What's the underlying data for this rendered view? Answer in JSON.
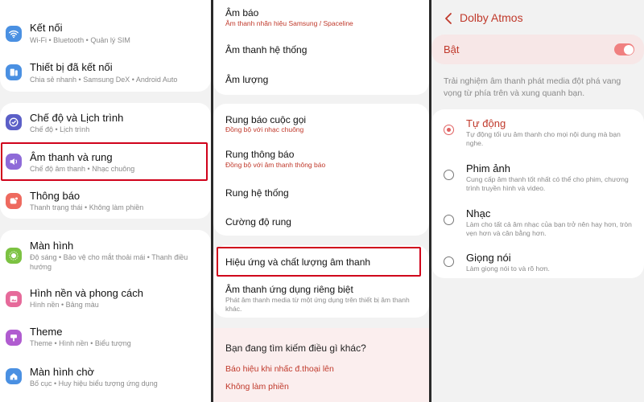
{
  "panel1": {
    "items": [
      {
        "title": "Kết nối",
        "subtitle": "Wi-Fi  •  Bluetooth  •  Quản lý SIM",
        "icon": "wifi-icon",
        "color": "#4a90e2"
      },
      {
        "title": "Thiết bị đã kết nối",
        "subtitle": "Chia sẻ nhanh  •  Samsung DeX  •  Android Auto",
        "icon": "devices-icon",
        "color": "#4a90e2"
      },
      {
        "title": "Chế độ và Lịch trình",
        "subtitle": "Chế độ  •  Lịch trình",
        "icon": "check-circle-icon",
        "color": "#5b5fc7"
      },
      {
        "title": "Âm thanh và rung",
        "subtitle": "Chế độ âm thanh  •  Nhạc chuông",
        "icon": "volume-icon",
        "color": "#8e6ad8"
      },
      {
        "title": "Thông báo",
        "subtitle": "Thanh trạng thái  •  Không làm phiền",
        "icon": "notification-icon",
        "color": "#ee6a5f"
      },
      {
        "title": "Màn hình",
        "subtitle": "Độ sáng  •  Bảo vệ cho mắt thoải mái  •  Thanh điều hướng",
        "icon": "sun-icon",
        "color": "#7cc242"
      },
      {
        "title": "Hình nền và phong cách",
        "subtitle": "Hình nền  •  Bảng màu",
        "icon": "image-icon",
        "color": "#e66a9a"
      },
      {
        "title": "Theme",
        "subtitle": "Theme  •  Hình nền  •  Biểu tượng",
        "icon": "theme-icon",
        "color": "#b05cd0"
      },
      {
        "title": "Màn hình chờ",
        "subtitle": "Bố cục  •  Huy hiệu biểu tượng ứng dụng",
        "icon": "home-icon",
        "color": "#4a90e2"
      }
    ]
  },
  "panel2": {
    "items": [
      {
        "title": "Âm báo",
        "subtitle": "Âm thanh nhãn hiệu Samsung / Spaceline"
      },
      {
        "title": "Âm thanh hệ thống",
        "subtitle": ""
      },
      {
        "title": "Âm lượng",
        "subtitle": ""
      },
      {
        "title": "Rung báo cuộc gọi",
        "subtitle": "Đồng bộ với nhạc chuông"
      },
      {
        "title": "Rung thông báo",
        "subtitle": "Đồng bộ với âm thanh thông báo"
      },
      {
        "title": "Rung hệ thống",
        "subtitle": ""
      },
      {
        "title": "Cường độ rung",
        "subtitle": ""
      },
      {
        "title": "Hiệu ứng và chất lượng âm thanh",
        "subtitle": ""
      },
      {
        "title": "Âm thanh ứng dụng riêng biệt",
        "subtitle": "Phát âm thanh media từ một ứng dụng trên thiết bị âm thanh khác."
      }
    ],
    "suggest": {
      "heading": "Bạn đang tìm kiếm điều gì khác?",
      "links": [
        "Báo hiệu khi nhấc đ.thoại lên",
        "Không làm phiền"
      ]
    }
  },
  "panel3": {
    "title": "Dolby Atmos",
    "toggle_label": "Bật",
    "toggle_on": true,
    "description": "Trải nghiệm âm thanh phát media đột phá vang vọng từ phía trên và xung quanh bạn.",
    "options": [
      {
        "title": "Tự động",
        "subtitle": "Tự động tối ưu âm thanh cho mọi nội dung mà bạn nghe.",
        "selected": true
      },
      {
        "title": "Phim ảnh",
        "subtitle": "Cung cấp âm thanh tốt nhất có thể cho phim, chương trình truyền hình và video.",
        "selected": false
      },
      {
        "title": "Nhạc",
        "subtitle": "Làm cho tất cả âm nhạc của bạn trở nên hay hơn, tròn vẹn hơn và cân bằng hơn.",
        "selected": false
      },
      {
        "title": "Giọng nói",
        "subtitle": "Làm giọng nói to và rõ hơn.",
        "selected": false
      }
    ]
  },
  "colors": {
    "accent": "#c0392b",
    "highlight_box": "#d0021b",
    "toggle": "#f08080"
  }
}
